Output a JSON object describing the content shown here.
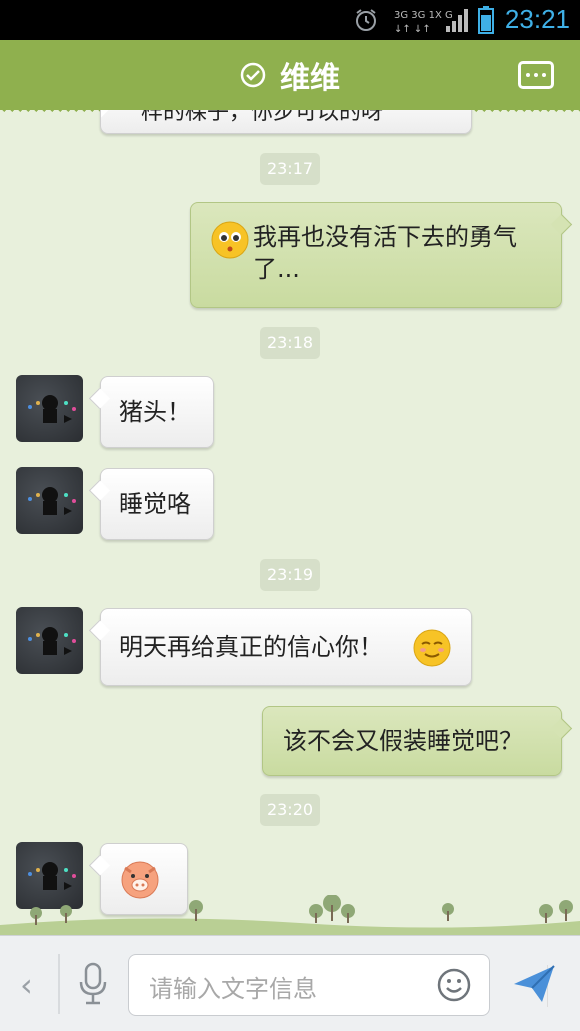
{
  "status_bar": {
    "time": "23:21"
  },
  "title_bar": {
    "title": "维维"
  },
  "chat": {
    "partial_top": "样的棵子，你步可以的呀",
    "timestamps": [
      "23:17",
      "23:18",
      "23:19",
      "23:20"
    ],
    "messages": [
      {
        "side": "right",
        "text": "我再也没有活下去的勇气了..."
      },
      {
        "side": "left",
        "text": "猪头！"
      },
      {
        "side": "left",
        "text": "睡觉咯"
      },
      {
        "side": "left",
        "text": "明天再给真正的信心你！"
      },
      {
        "side": "right",
        "text": "该不会又假装睡觉吧？"
      },
      {
        "side": "left",
        "text": ""
      }
    ]
  },
  "input_bar": {
    "placeholder": "请输入文字信息"
  },
  "colors": {
    "title_bar": "#8fb04e",
    "chat_bg": "#e8f0dc",
    "bubble_right": "#d0e0a8",
    "accent_blue": "#3fb0e6"
  },
  "icons": [
    "alarm-icon",
    "signal-icon",
    "battery-icon",
    "verified-icon",
    "menu-icon",
    "sad-face-emoji",
    "smile-emoji",
    "pig-emoji",
    "back-chevron-icon",
    "microphone-icon",
    "emoji-icon",
    "send-icon"
  ]
}
